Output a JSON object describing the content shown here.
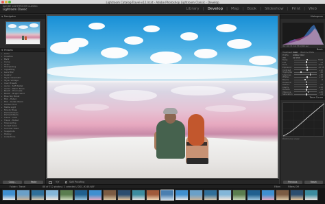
{
  "window": {
    "title": "Lightroom Catalog-Travel-v12.lrcat - Adobe Photoshop Lightroom Classic - Develop"
  },
  "identity": {
    "line1": "ADOBE LIGHTROOM CLASSIC",
    "line2": "Lightroom Classic"
  },
  "modules": [
    {
      "label": "Library",
      "active": false
    },
    {
      "label": "Develop",
      "active": true
    },
    {
      "label": "Map",
      "active": false
    },
    {
      "label": "Book",
      "active": false
    },
    {
      "label": "Slideshow",
      "active": false
    },
    {
      "label": "Print",
      "active": false
    },
    {
      "label": "Web",
      "active": false
    }
  ],
  "left_panel": {
    "navigator_title": "Navigator",
    "presets_title": "Presets",
    "preset_groups": [
      "Color",
      "Creative",
      "B&W",
      "Curve",
      "Grain",
      "Sharpening",
      "Vignetting",
      "Lens Blur",
      "Legacy",
      "Style: Cinematic",
      "Style: Vintage",
      "User Presets",
      "Aerial - Soft Pastel",
      "Aerial - Warm Tones",
      "Beach - Pink Lake",
      "Beach - Bright Sand",
      "Blue Sky Boost",
      "Film - Faded",
      "Film - Kodak Warm",
      "Golden Hour",
      "Matte Light",
      "Moody Blues",
      "Portrait Clean",
      "Portrait Warm",
      "Travel - Vivid",
      "Travel - Muted",
      "Tropical Pop",
      "Sunset Glow",
      "Summer Haze",
      "Snapshots",
      "History",
      "Collections"
    ],
    "copy_button": "Copy...",
    "paste_button": "Paste"
  },
  "toolbar": {
    "view_icon": "loupe-view-icon",
    "before_after_label": "Y|Y",
    "soft_proof_label": "Soft Proofing"
  },
  "right_panel": {
    "histogram_title": "Histogram",
    "info_line": "ISO 100   35 mm   f/8   1/500 sec",
    "basic_title": "Basic",
    "treatment": {
      "label": "Treatment",
      "color": "Color",
      "bw": "Black & White"
    },
    "profile": {
      "label": "Profile",
      "value": "Adobe Color"
    },
    "wb": {
      "label": "WB",
      "value": "As Shot"
    },
    "sliders": [
      {
        "label": "Temp",
        "value": "5500",
        "pos": 0.55
      },
      {
        "label": "Tint",
        "value": "+8",
        "pos": 0.53
      },
      {
        "label": "Tone",
        "value": "Auto",
        "pos": 0.5
      },
      {
        "label": "Exposure",
        "value": "+0.35",
        "pos": 0.56
      },
      {
        "label": "Contrast",
        "value": "+12",
        "pos": 0.56
      },
      {
        "label": "Highlights",
        "value": "-45",
        "pos": 0.28
      },
      {
        "label": "Shadows",
        "value": "+38",
        "pos": 0.69
      },
      {
        "label": "Whites",
        "value": "+10",
        "pos": 0.55
      },
      {
        "label": "Blacks",
        "value": "-8",
        "pos": 0.46
      },
      {
        "label": "Presence",
        "value": "",
        "pos": 0.5
      },
      {
        "label": "Texture",
        "value": "+5",
        "pos": 0.52
      },
      {
        "label": "Clarity",
        "value": "+10",
        "pos": 0.55
      },
      {
        "label": "Dehaze",
        "value": "+6",
        "pos": 0.53
      },
      {
        "label": "Vibrance",
        "value": "+20",
        "pos": 0.6
      },
      {
        "label": "Saturation",
        "value": "+4",
        "pos": 0.52
      }
    ],
    "tone_curve_title": "Tone Curve",
    "curve_footer": "Point Curve: Linear",
    "previous_button": "Previous",
    "reset_button": "Reset"
  },
  "filmstrip_bar": {
    "source": "Folder : Travel",
    "count": "88 of 712 photos / 1 selected / DSC_9248.NEF",
    "filter_label": "Filter :",
    "filter_value": "Filters Off"
  },
  "colors": {
    "accent": "#e6e6e6",
    "panel": "#2b2b2b",
    "background": "#3a3a3a"
  }
}
